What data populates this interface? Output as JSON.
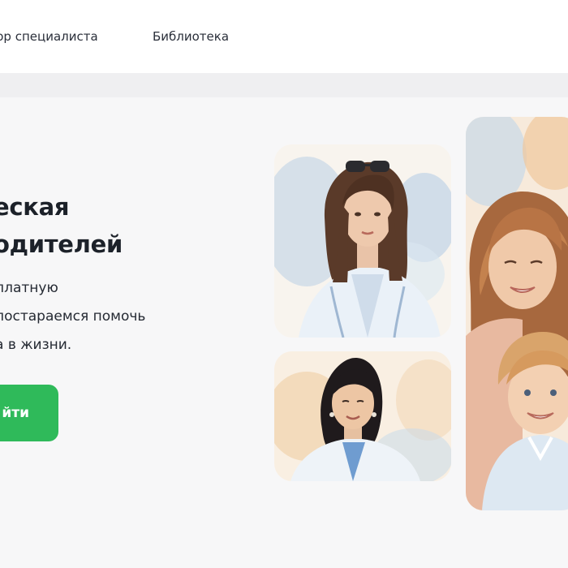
{
  "nav": {
    "items": [
      {
        "label": "бор специалиста"
      },
      {
        "label": "Библиотека"
      }
    ]
  },
  "hero": {
    "title_lines": [
      "еская",
      "одителей"
    ],
    "description_lines": [
      "платную",
      "постараемся помочь",
      "а в жизни."
    ],
    "cta_label": "йти"
  },
  "colors": {
    "accent": "#2fba5a",
    "page_background": "#f7f7f8",
    "nav_background": "#ffffff"
  },
  "images": [
    {
      "name": "portrait-woman-sunglasses",
      "alt": "watercolor portrait of a woman with sunglasses on her head"
    },
    {
      "name": "portrait-asian-woman",
      "alt": "watercolor portrait of a smiling woman in a white coat"
    },
    {
      "name": "portrait-mother-child",
      "alt": "watercolor portrait of a mother and child"
    }
  ]
}
